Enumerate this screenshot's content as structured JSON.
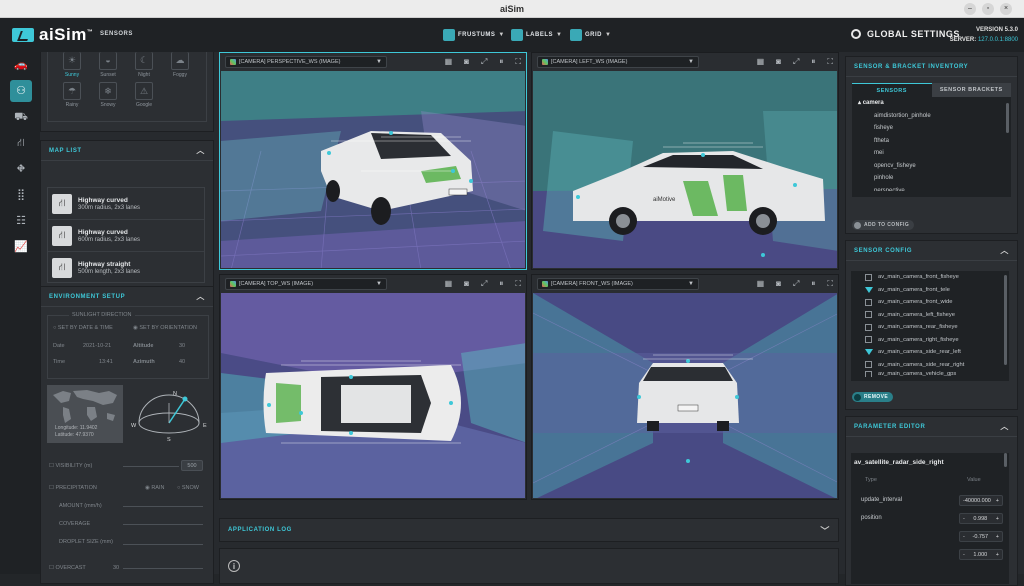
{
  "window": {
    "title": "aiSim"
  },
  "header": {
    "logo": "aiSim",
    "logo_tm": "™",
    "section": "SENSORS",
    "toolbar": [
      {
        "label": "FRUSTUMS",
        "icon": "frustum-icon"
      },
      {
        "label": "LABELS",
        "icon": "label-icon"
      },
      {
        "label": "GRID",
        "icon": "grid-icon"
      }
    ],
    "global_settings": "GLOBAL SETTINGS",
    "version": "VERSION 5.3.0",
    "server_label": "SERVER:",
    "server_value": "127.0.0.1:8800"
  },
  "rail": [
    {
      "icon": "car-icon"
    },
    {
      "icon": "sensor-car-icon"
    },
    {
      "icon": "traffic-icon"
    },
    {
      "icon": "road-icon"
    },
    {
      "icon": "road-ds-icon"
    },
    {
      "icon": "apps-icon"
    },
    {
      "icon": "scenario-icon"
    },
    {
      "icon": "chart-icon"
    }
  ],
  "weather": [
    {
      "label": "Sunny",
      "icon": "sun-icon"
    },
    {
      "label": "Sunset",
      "icon": "sunset-icon"
    },
    {
      "label": "Night",
      "icon": "moon-icon"
    },
    {
      "label": "Foggy",
      "icon": "fog-icon"
    },
    {
      "label": "Rainy",
      "icon": "rain-icon"
    },
    {
      "label": "Snowy",
      "icon": "snow-icon"
    },
    {
      "label": "Google",
      "icon": "google-icon"
    }
  ],
  "map_list": {
    "title": "MAP LIST",
    "items": [
      {
        "name": "Highway curved",
        "desc": "300m radius, 2x3 lanes"
      },
      {
        "name": "Highway curved",
        "desc": "600m radius, 2x3 lanes"
      },
      {
        "name": "Highway straight",
        "desc": "500m length, 2x3 lanes"
      }
    ]
  },
  "environment": {
    "title": "ENVIRONMENT SETUP",
    "sunlight": "SUNLIGHT DIRECTION",
    "by_date": "SET BY DATE & TIME",
    "by_orientation": "SET BY ORIENTATION",
    "date_label": "Date",
    "date_value": "2021-10-21",
    "time_label": "Time",
    "time_value": "13:41",
    "altitude_label": "Altitude",
    "altitude_value": "30",
    "azimuth_label": "Azimuth",
    "azimuth_value": "40",
    "longitude": "Longitude: 11.9402",
    "latitude": "Latitude: 47.9370",
    "compass": [
      "N",
      "W",
      "E",
      "S"
    ],
    "visibility_label": "VISIBILITY (m)",
    "visibility_value": "500",
    "precipitation_label": "PRECIPITATION",
    "rain": "RAIN",
    "snow": "SNOW",
    "amount_label": "AMOUNT (mm/h)",
    "coverage_label": "COVERAGE",
    "radius_label": "DROPLET SIZE (mm)",
    "overcast_label": "OVERCAST",
    "overcast_value": "30"
  },
  "viewports": [
    {
      "source": "[CAMERA]   PERSPECTIVE_WS (IMAGE)"
    },
    {
      "source": "[CAMERA]   LEFT_WS (IMAGE)"
    },
    {
      "source": "[CAMERA]   TOP_WS (IMAGE)"
    },
    {
      "source": "[CAMERA]   FRONT_WS (IMAGE)"
    }
  ],
  "car_brand": "aiMotive",
  "application_log": {
    "title": "APPLICATION LOG"
  },
  "inventory": {
    "title": "SENSOR & BRACKET INVENTORY",
    "tabs": [
      "SENSORS",
      "SENSOR BRACKETS"
    ],
    "root": "camera",
    "items": [
      "aimdistortion_pinhole",
      "fisheye",
      "ftheta",
      "mei",
      "opencv_fisheye",
      "pinhole",
      "perspective"
    ],
    "add_button": "ADD TO CONFIG"
  },
  "sensor_config": {
    "title": "SENSOR CONFIG",
    "items": [
      "av_main_camera_front_fisheye",
      "av_main_camera_front_tele",
      "av_main_camera_front_wide",
      "av_main_camera_left_fisheye",
      "av_main_camera_rear_fisheye",
      "av_main_camera_right_fisheye",
      "av_main_camera_side_rear_left",
      "av_main_camera_side_rear_right",
      "av_main_camera_vehicle_gps"
    ],
    "remove_button": "REMOVE"
  },
  "parameter_editor": {
    "title": "PARAMETER EDITOR",
    "sensor": "av_satellite_radar_side_right",
    "col_type": "Type",
    "col_value": "Value",
    "update_label": "update_interval",
    "update_value": "-40000.000",
    "position_label": "position",
    "position_values": [
      "0.998",
      "-0.757",
      "1.000"
    ]
  },
  "colors": {
    "accent": "#3ec8d8",
    "panel": "#2c2f33",
    "background": "#272a2e"
  }
}
